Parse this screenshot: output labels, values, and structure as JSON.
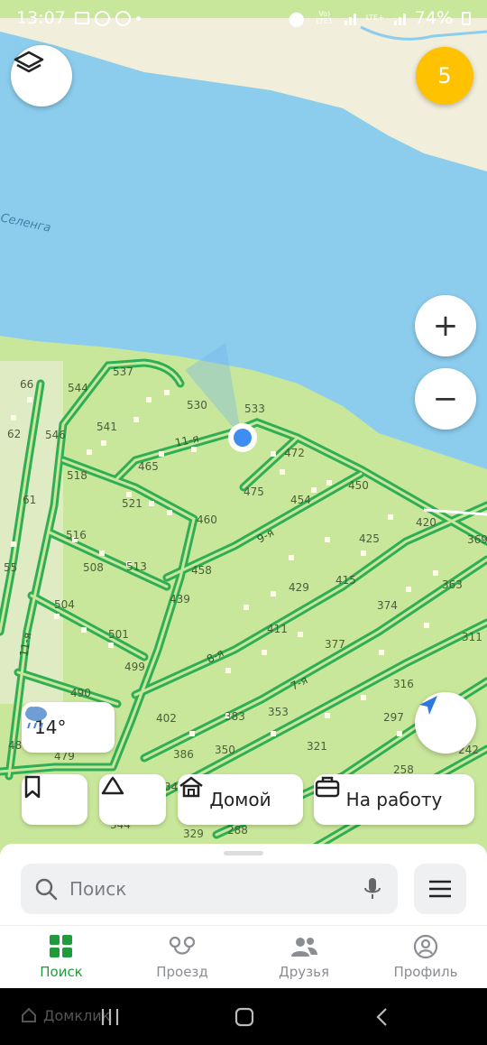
{
  "status_bar": {
    "time": "13:07",
    "network_1": "Vo) LTE1",
    "network_2": "LTE+",
    "battery": "74%"
  },
  "map": {
    "river_label": "Селенга",
    "street_labels": [
      "11-я",
      "9-я",
      "8-я",
      "7-я",
      "11-я"
    ],
    "plot_numbers": [
      "537",
      "544",
      "530",
      "533",
      "66",
      "541",
      "546",
      "472",
      "62",
      "465",
      "518",
      "475",
      "454",
      "450",
      "61",
      "521",
      "460",
      "420",
      "516",
      "425",
      "369",
      "55",
      "508",
      "513",
      "458",
      "429",
      "415",
      "363",
      "439",
      "504",
      "374",
      "411",
      "501",
      "377",
      "311",
      "499",
      "490",
      "402",
      "383",
      "353",
      "316",
      "321",
      "297",
      "48",
      "479",
      "386",
      "350",
      "258",
      "242",
      "34",
      "344",
      "329",
      "288"
    ]
  },
  "controls": {
    "layers_icon": "layers-icon",
    "badge_count": "5",
    "zoom_in": "+",
    "zoom_out": "−",
    "locate_icon": "navigation-arrow-icon"
  },
  "weather": {
    "temp": "14°",
    "icon": "rain-cloud-icon"
  },
  "quick_chips": {
    "bookmark_icon": "bookmark-icon",
    "alert_icon": "bell-icon",
    "home_label": "Домой",
    "work_label": "На работу"
  },
  "search": {
    "placeholder": "Поиск"
  },
  "tabs": [
    {
      "label": "Поиск",
      "icon": "grid-icon",
      "active": true
    },
    {
      "label": "Проезд",
      "icon": "route-icon",
      "active": false
    },
    {
      "label": "Друзья",
      "icon": "friends-icon",
      "active": false
    },
    {
      "label": "Профиль",
      "icon": "profile-icon",
      "active": false
    }
  ],
  "system_nav": {
    "watermark": "Домклик"
  },
  "colors": {
    "water": "#8ccdee",
    "land": "#c9e79a",
    "sand": "#f1eedb",
    "road": "#2fae56",
    "accent": "#1f9b3b",
    "badge": "#ffc200",
    "location": "#3d8ef0"
  }
}
